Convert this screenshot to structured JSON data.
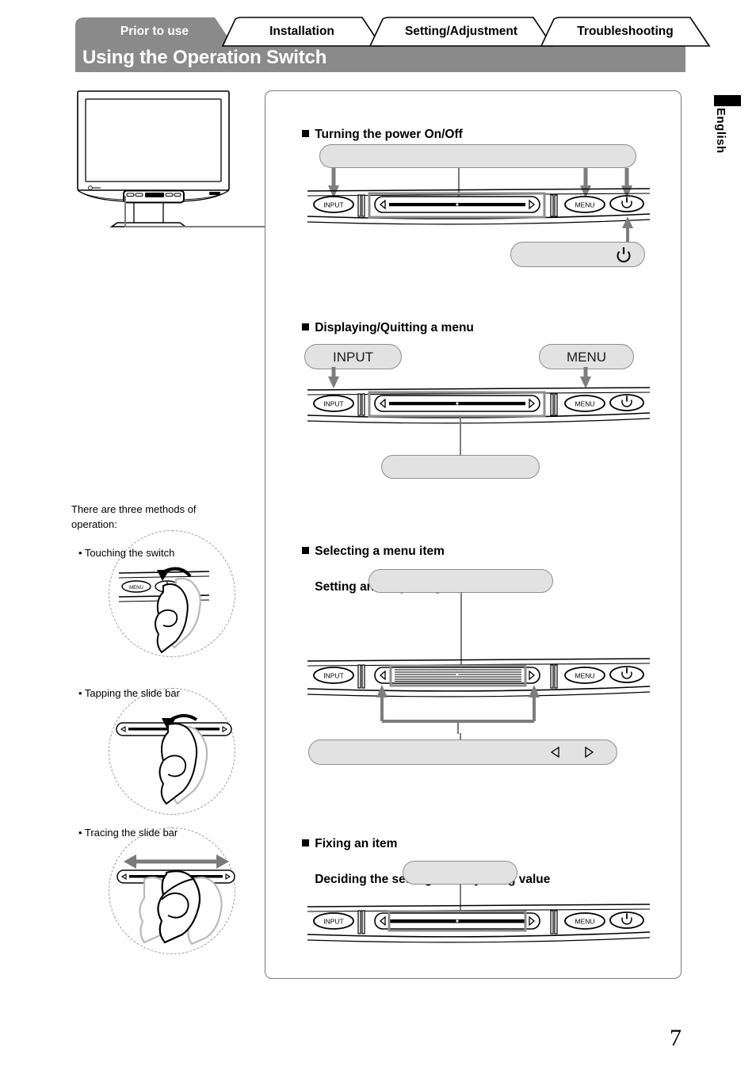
{
  "header": {
    "tabs": [
      {
        "label": "Prior to use",
        "active": true
      },
      {
        "label": "Installation",
        "active": false
      },
      {
        "label": "Setting/Adjustment",
        "active": false
      },
      {
        "label": "Troubleshooting",
        "active": false
      }
    ],
    "title": "Using the Operation Switch",
    "active_tab_bg": "#8a8a8a",
    "banner_bg": "#8a8a8a",
    "banner_text_color": "#ffffff"
  },
  "side_tab": {
    "language_label": "English"
  },
  "sections": [
    {
      "id": "power",
      "heading_line1": "Turning the power On/Off",
      "heading_line2": "",
      "callouts": [
        {
          "name": "top-wide-callout",
          "text": ""
        },
        {
          "name": "power-symbol-callout",
          "text": "",
          "icon": "power-icon"
        }
      ]
    },
    {
      "id": "menu",
      "heading_line1": "Displaying/Quitting a menu",
      "heading_line2": "",
      "callouts": [
        {
          "name": "input-callout",
          "text": "INPUT"
        },
        {
          "name": "menu-callout",
          "text": "MENU"
        },
        {
          "name": "slidebar-callout",
          "text": ""
        }
      ]
    },
    {
      "id": "select",
      "heading_line1": "Selecting a menu item",
      "heading_line2": "Setting and Adjusting",
      "callouts": [
        {
          "name": "slidebar-top-callout",
          "text": ""
        },
        {
          "name": "arrows-callout",
          "text": "",
          "icons": [
            "triangle-left-icon",
            "triangle-right-icon"
          ]
        }
      ]
    },
    {
      "id": "fixing",
      "heading_line1": "Fixing an item",
      "heading_line2": "Deciding the setting and adjusting value",
      "callouts": [
        {
          "name": "fix-callout",
          "text": ""
        }
      ]
    }
  ],
  "control_panel": {
    "input_button_label": "INPUT",
    "menu_button_label": "MENU",
    "power_button_icon": "power-icon",
    "slide_left_icon": "triangle-left-icon",
    "slide_right_icon": "triangle-right-icon"
  },
  "sidebar": {
    "intro": "There are three methods of operation:",
    "methods": [
      {
        "label": "• Touching the switch",
        "illustration": "hand-touching-switch"
      },
      {
        "label": "• Tapping the slide bar",
        "illustration": "hand-tapping-slidebar"
      },
      {
        "label": "• Tracing the slide bar",
        "illustration": "hand-tracing-slidebar"
      }
    ],
    "mini_menu_label": "MENU",
    "mini_power_icon": "power-icon"
  },
  "footer": {
    "page_number": "7"
  },
  "colors": {
    "grey_banner": "#8a8a8a",
    "bubble_fill": "#e2e2e2",
    "bubble_stroke": "#8d8d8d",
    "connector": "#7d7d7d",
    "frame_border": "#7a7a7a"
  }
}
